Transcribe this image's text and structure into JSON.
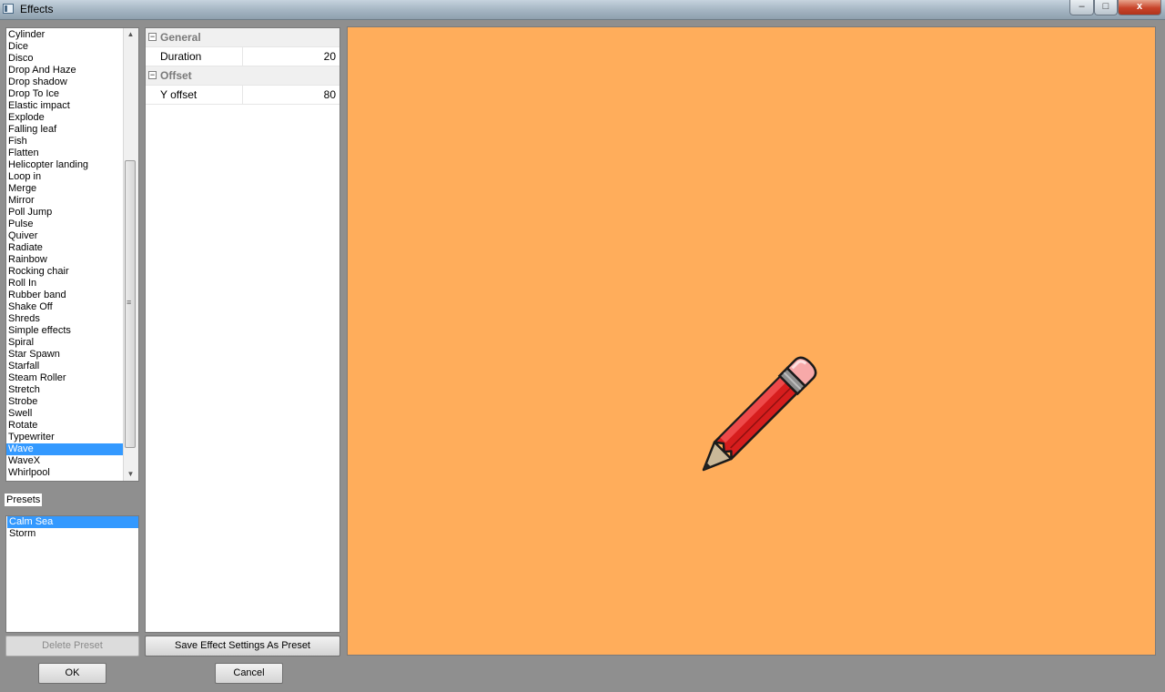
{
  "window": {
    "title": "Effects",
    "minimize_glyph": "–",
    "maximize_glyph": "□",
    "close_glyph": "x"
  },
  "effects": {
    "items": [
      "Cylinder",
      "Dice",
      "Disco",
      "Drop And Haze",
      "Drop shadow",
      "Drop To Ice",
      "Elastic impact",
      "Explode",
      "Falling leaf",
      "Fish",
      "Flatten",
      "Helicopter landing",
      "Loop in",
      "Merge",
      "Mirror",
      "Poll Jump",
      "Pulse",
      "Quiver",
      "Radiate",
      "Rainbow",
      "Rocking chair",
      "Roll In",
      "Rubber band",
      "Shake Off",
      "Shreds",
      "Simple effects",
      "Spiral",
      "Star Spawn",
      "Starfall",
      "Steam Roller",
      "Stretch",
      "Strobe",
      "Swell",
      "Rotate",
      "Typewriter",
      "Wave",
      "WaveX",
      "Whirlpool"
    ],
    "selected": "Wave"
  },
  "presets": {
    "label": "Presets",
    "items": [
      "Calm Sea",
      "Storm"
    ],
    "selected": "Calm Sea"
  },
  "properties": {
    "groups": [
      {
        "name": "General",
        "rows": [
          {
            "name": "Duration",
            "value": "20"
          }
        ]
      },
      {
        "name": "Offset",
        "rows": [
          {
            "name": "Y offset",
            "value": "80"
          }
        ]
      }
    ]
  },
  "buttons": {
    "delete_preset": "Delete Preset",
    "save_preset": "Save Effect Settings As Preset",
    "ok": "OK",
    "cancel": "Cancel"
  },
  "preview": {
    "background": "#ffad5b",
    "object": "pencil-icon"
  },
  "colors": {
    "selection": "#3399ff",
    "pencil_body": "#d61d1d",
    "eraser": "#f7a9a9"
  }
}
